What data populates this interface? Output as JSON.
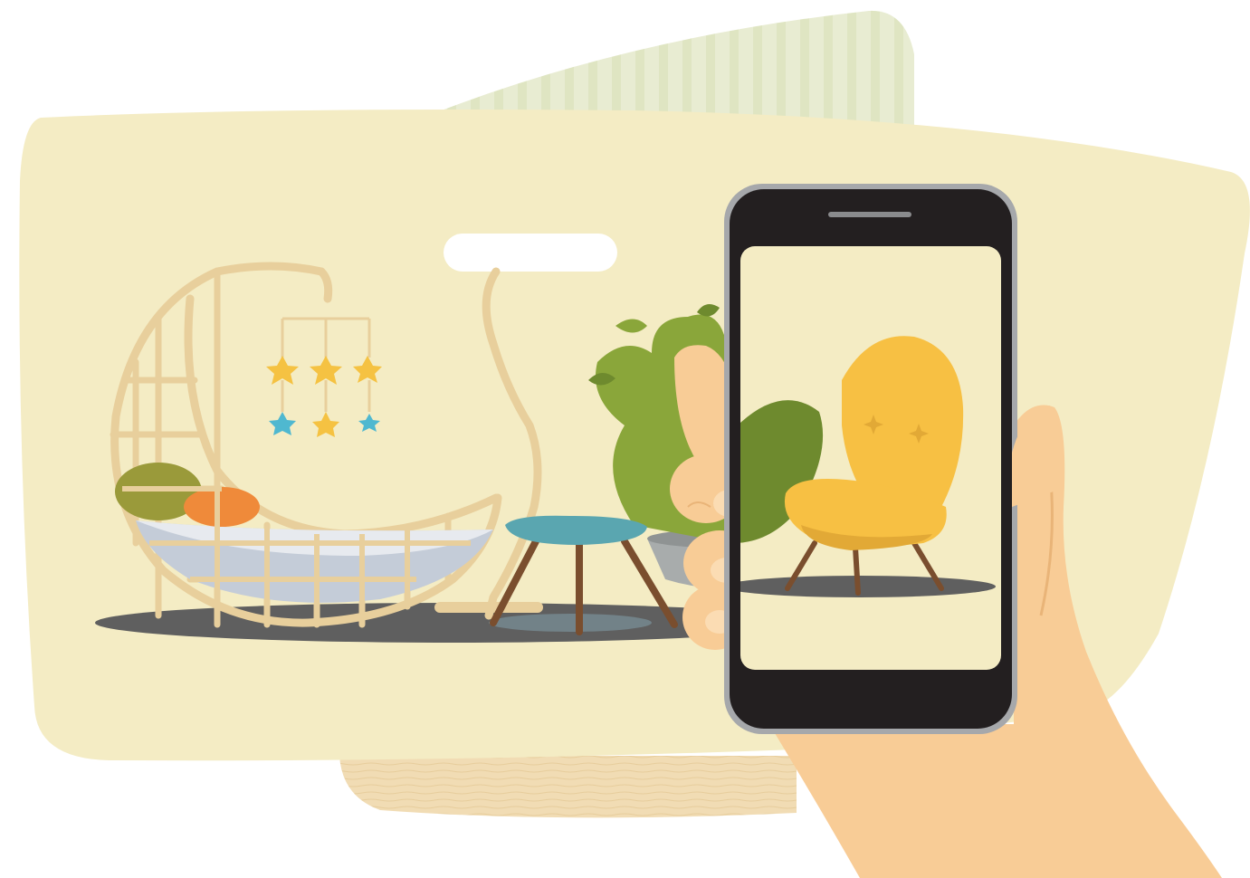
{
  "scene": {
    "subject": "hand-holding-smartphone-photographing-furniture",
    "elements": [
      "hanging-egg-chair",
      "star-mobile",
      "floor-lamp",
      "footstool",
      "potted-plant",
      "yellow-armchair",
      "smartphone",
      "hand"
    ]
  },
  "colors": {
    "background_wall": "#f4ecc4",
    "stripe_panel": "#e8ecd2",
    "floor_wood": "#f1dcb4",
    "chair_frame": "#e8cf9c",
    "cushion_orange": "#ef8a3a",
    "cushion_olive": "#9a9a3a",
    "seat_blue": "#c4ccd8",
    "stool_teal": "#5aa6b0",
    "wood_leg": "#7a4e2e",
    "plant_green": "#8aa63a",
    "plant_dark": "#6e8a2e",
    "pot_gray": "#a8acac",
    "armchair_yellow": "#f7c043",
    "armchair_shade": "#e2a936",
    "phone_body": "#231f20",
    "phone_rim": "#a6a8ab",
    "screen_bg": "#f4ecc4",
    "skin": "#f8cc96",
    "skin_shade": "#e9b478",
    "floor_shadow": "#5f5f5f",
    "star_yellow": "#f5c242",
    "star_blue": "#4fb8d0"
  }
}
